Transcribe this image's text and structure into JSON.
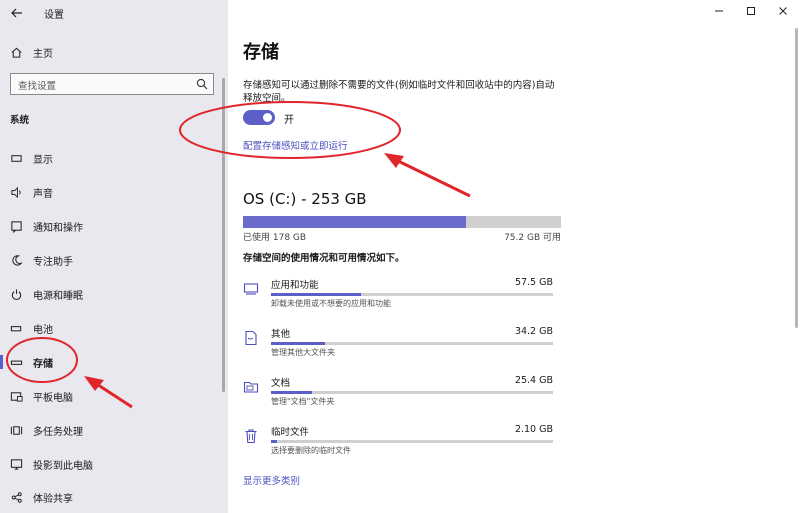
{
  "window": {
    "title": "设置",
    "controls": {
      "minimize": "minimize-icon",
      "maximize": "maximize-icon",
      "close": "close-icon"
    }
  },
  "sidebar": {
    "home_label": "主页",
    "search_placeholder": "查找设置",
    "section_title": "系统",
    "items": [
      {
        "label": "显示",
        "icon": "display-icon"
      },
      {
        "label": "声音",
        "icon": "speaker-icon"
      },
      {
        "label": "通知和操作",
        "icon": "notification-icon"
      },
      {
        "label": "专注助手",
        "icon": "moon-icon"
      },
      {
        "label": "电源和睡眠",
        "icon": "power-icon"
      },
      {
        "label": "电池",
        "icon": "battery-icon"
      },
      {
        "label": "存储",
        "icon": "storage-icon",
        "active": true
      },
      {
        "label": "平板电脑",
        "icon": "tablet-icon"
      },
      {
        "label": "多任务处理",
        "icon": "multitask-icon"
      },
      {
        "label": "投影到此电脑",
        "icon": "project-icon"
      },
      {
        "label": "体验共享",
        "icon": "share-icon"
      }
    ]
  },
  "main": {
    "title": "存储",
    "description": "存储感知可以通过删除不需要的文件(例如临时文件和回收站中的内容)自动释放空间。",
    "toggle": {
      "state": "on",
      "label": "开"
    },
    "config_link": "配置存储感知或立即运行",
    "drive": {
      "title": "OS (C:) - 253 GB",
      "used_label": "已使用 178 GB",
      "free_label": "75.2 GB 可用",
      "used_fraction": 0.7
    },
    "usage_description": "存储空间的使用情况和可用情况如下。",
    "categories": [
      {
        "name": "应用和功能",
        "size": "57.5 GB",
        "subtitle": "卸载未使用或不想要的应用和功能",
        "fraction": 0.32,
        "icon": "apps-icon"
      },
      {
        "name": "其他",
        "size": "34.2 GB",
        "subtitle": "管理其他大文件夹",
        "fraction": 0.19,
        "icon": "other-file-icon"
      },
      {
        "name": "文档",
        "size": "25.4 GB",
        "subtitle": "管理\"文档\"文件夹",
        "fraction": 0.145,
        "icon": "folder-icon"
      },
      {
        "name": "临时文件",
        "size": "2.10 GB",
        "subtitle": "选择要删除的临时文件",
        "fraction": 0.02,
        "icon": "trash-icon"
      }
    ],
    "more_link": "显示更多类别"
  },
  "colors": {
    "accent": "#5b5fc7",
    "annotation": "#e0262b",
    "sidebar_bg": "#e9e8ee"
  }
}
